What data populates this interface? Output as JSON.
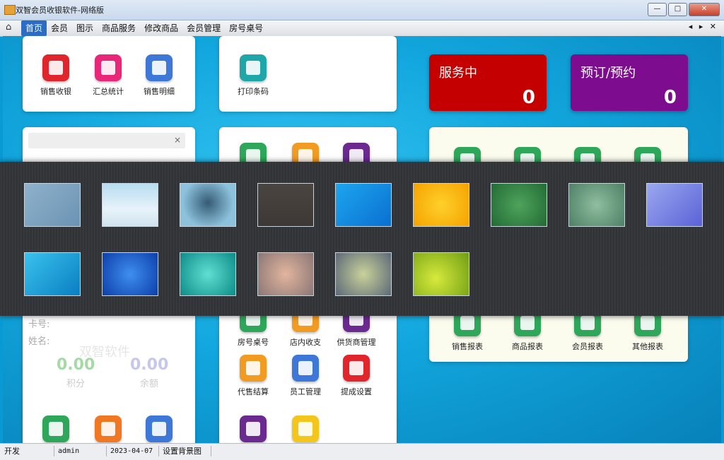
{
  "window": {
    "title": "双智会员收银软件-网络版",
    "buttons": {
      "minimize": "—",
      "maximize": "□",
      "close": "✕"
    }
  },
  "menu": {
    "items": [
      "首页",
      "会员",
      "图示",
      "商品服务",
      "修改商品",
      "会员管理",
      "房号桌号"
    ],
    "active_index": 0,
    "arrows": "◂ ▸ ✕"
  },
  "tiles": {
    "sales_cashier": "销售收银",
    "summary_stats": "汇总统计",
    "sales_detail": "销售明细",
    "print_barcode": "打印条码",
    "room_table": "房号桌号",
    "store_income": "店内收支",
    "supplier_mgmt": "供货商管理",
    "agency_settle": "代售结算",
    "staff_mgmt": "员工管理",
    "commission_settings": "提成设置",
    "sales_report": "销售报表",
    "goods_report": "商品报表",
    "member_report": "会员报表",
    "other_report": "其他报表"
  },
  "status_cards": {
    "in_service": {
      "label": "服务中",
      "count": "0",
      "color": "#c40000"
    },
    "reservation": {
      "label": "预订/预约",
      "count": "0",
      "color": "#7d0d8e"
    }
  },
  "member_panel": {
    "search_clear": "×",
    "card_label": "卡号:",
    "name_label": "姓名:",
    "watermark": "双智软件",
    "points_value": "0.00",
    "points_label": "积分",
    "balance_value": "0.00",
    "balance_label": "余额"
  },
  "statusbar": {
    "mode": "开发",
    "user": "admin",
    "date": "2023-04-07",
    "action": "设置背景图"
  },
  "colors": {
    "accent": "#2b6cc4",
    "desktop_bg": "#12a7de",
    "report_card_bg": "#fbfcee",
    "icon_red": "#e0262c",
    "icon_pink": "#e8267a",
    "icon_blue": "#3d78d8",
    "icon_teal": "#1fa6a8",
    "icon_green": "#2fa75b",
    "icon_orange": "#f29b22",
    "icon_purple": "#6a2a8f",
    "icon_yellow": "#f2c61a"
  }
}
